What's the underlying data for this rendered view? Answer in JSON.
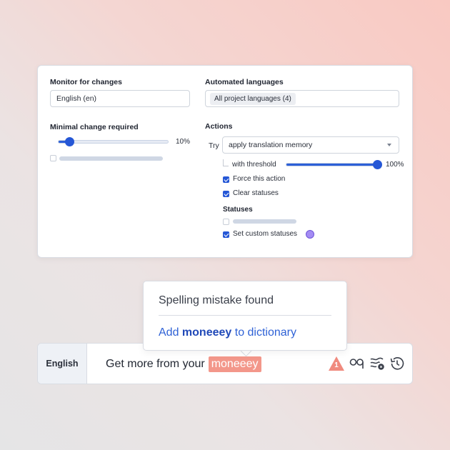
{
  "settings": {
    "monitor_label": "Monitor for changes",
    "monitor_value": "English (en)",
    "automated_label": "Automated languages",
    "automated_chip": "All project languages (4)",
    "minimal_label": "Minimal change required",
    "minimal_slider_value": 0.1,
    "minimal_pct": "10%",
    "actions_label": "Actions",
    "try_label": "Try",
    "action_select": "apply translation memory",
    "threshold_label": "with threshold",
    "threshold_slider_value": 1.0,
    "threshold_pct": "100%",
    "force_label": "Force this action",
    "force_checked": true,
    "clear_label": "Clear statuses",
    "clear_checked": true,
    "statuses_label": "Statuses",
    "custom_label": "Set custom statuses",
    "custom_checked": true,
    "custom_status_color": "#a48cf3"
  },
  "popup": {
    "title": "Spelling mistake found",
    "action_prefix": "Add ",
    "action_word": "moneeey",
    "action_suffix": " to dictionary"
  },
  "editor": {
    "language": "English",
    "text_before": "Get more from your",
    "misspelled": "moneeey",
    "warning_count": "1",
    "icons": [
      "warning-icon",
      "glasses-icon",
      "text-wrap-icon",
      "history-icon"
    ]
  },
  "colors": {
    "accent": "#2557d6",
    "link": "#2f62d6",
    "error_highlight": "#f3978a",
    "warning": "#f08a7e"
  }
}
